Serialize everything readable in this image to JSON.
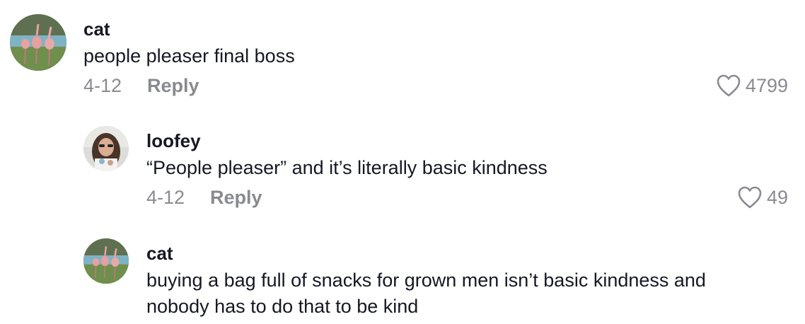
{
  "comments": [
    {
      "username": "cat",
      "text": "people pleaser final boss",
      "date": "4-12",
      "reply_label": "Reply",
      "likes": "4799"
    },
    {
      "username": "loofey",
      "text": "“People pleaser” and it’s literally basic kindness",
      "date": "4-12",
      "reply_label": "Reply",
      "likes": "49"
    },
    {
      "username": "cat",
      "text": "buying a bag full of snacks for grown men isn’t basic kindness and nobody has to do that to be kind"
    }
  ],
  "colors": {
    "text": "#161823",
    "muted": "#8a8b91"
  },
  "icons": {
    "like": "heart-outline-icon"
  }
}
